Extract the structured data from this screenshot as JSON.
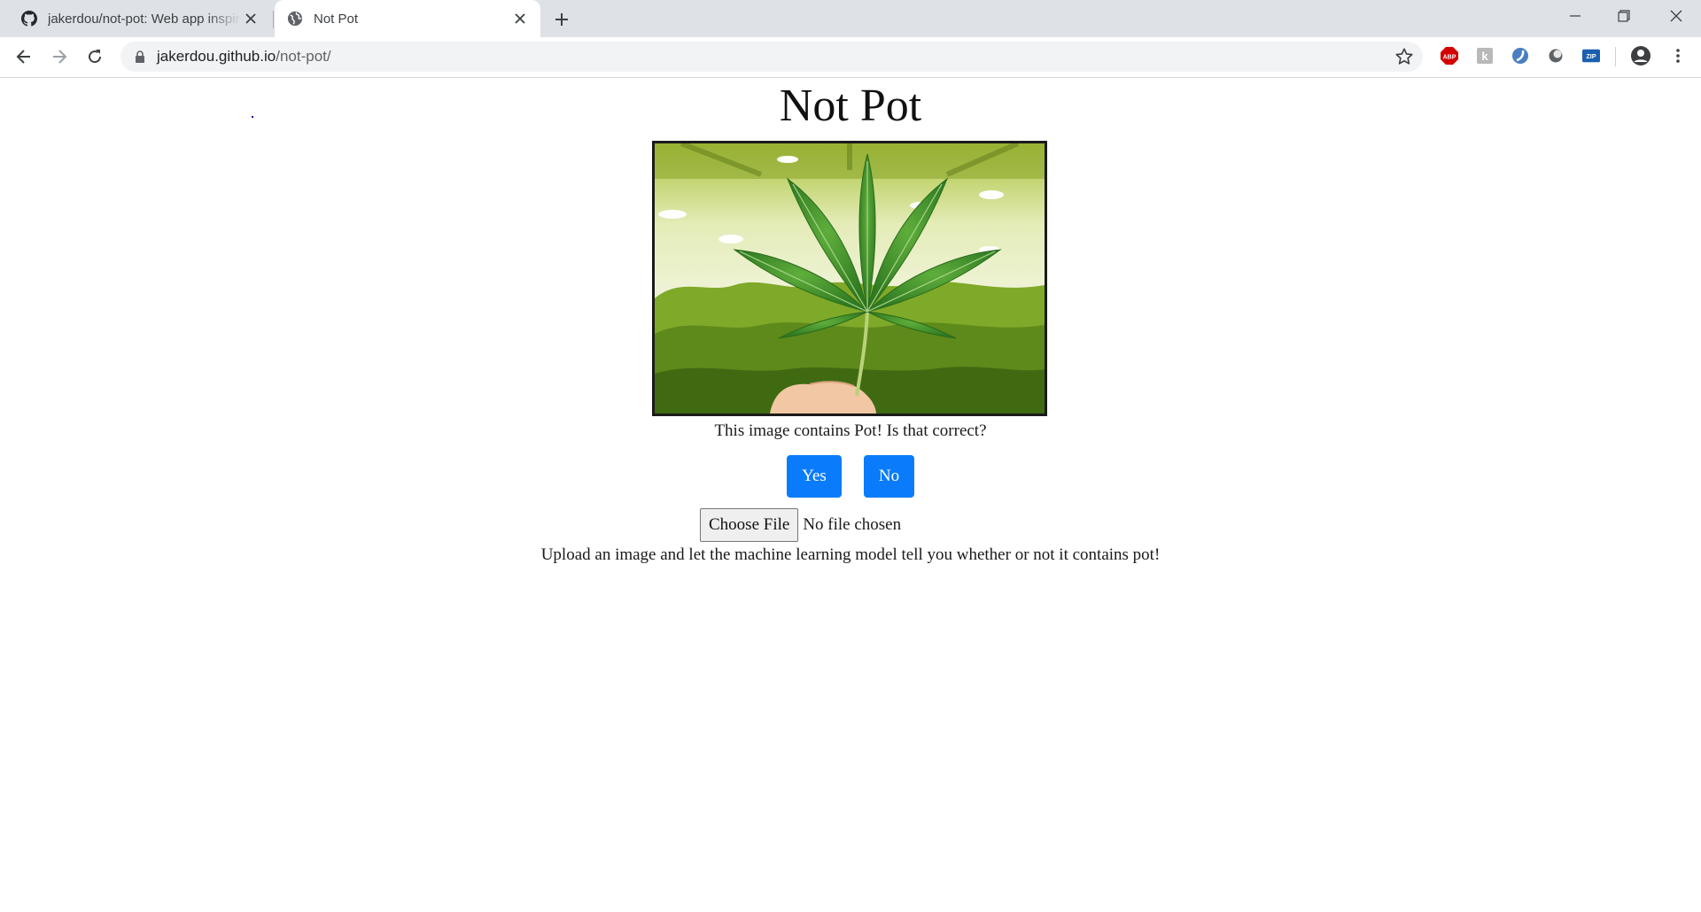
{
  "browser": {
    "tabs": [
      {
        "title": "jakerdou/not-pot: Web app inspired",
        "favicon": "github-icon",
        "active": false
      },
      {
        "title": "Not Pot",
        "favicon": "globe-icon",
        "active": true
      }
    ],
    "url_host": "jakerdou.github.io",
    "url_path": "/not-pot/",
    "extensions": [
      "adblock-plus-icon",
      "k-extension-icon",
      "edge-extension-icon",
      "circle-extension-icon",
      "zip-extension-icon"
    ],
    "colors": {
      "tabstrip": "#dee1e6",
      "omnibox": "#f1f3f4",
      "abp": "#d20000"
    }
  },
  "page": {
    "title": "Not Pot",
    "image_alt": "cannabis leaf held up in grow room",
    "caption": "This image contains Pot! Is that correct?",
    "yes_label": "Yes",
    "no_label": "No",
    "choose_file_label": "Choose File",
    "no_file_text": "No file chosen",
    "hint": "Upload an image and let the machine learning model tell you whether or not it contains pot!",
    "accent": "#0a7cfb"
  }
}
